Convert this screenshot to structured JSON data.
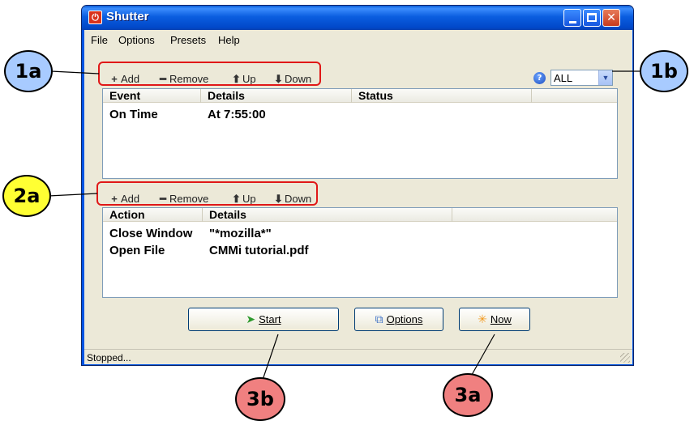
{
  "window": {
    "title": "Shutter"
  },
  "menu": [
    "File",
    "Options",
    "Presets",
    "Help"
  ],
  "event_toolbar": {
    "add": "Add",
    "remove": "Remove",
    "up": "Up",
    "down": "Down"
  },
  "action_toolbar": {
    "add": "Add",
    "remove": "Remove",
    "up": "Up",
    "down": "Down"
  },
  "filter": {
    "value": "ALL"
  },
  "events_table": {
    "headers": [
      "Event",
      "Details",
      "Status"
    ],
    "rows": [
      {
        "event": "On Time",
        "details": "At 7:55:00",
        "status": ""
      }
    ]
  },
  "actions_table": {
    "headers": [
      "Action",
      "Details"
    ],
    "rows": [
      {
        "action": "Close Window",
        "details": "\"*mozilla*\""
      },
      {
        "action": "Open File",
        "details": "CMMi tutorial.pdf"
      }
    ]
  },
  "buttons": {
    "start": "Start",
    "options": "Options",
    "now": "Now"
  },
  "status": {
    "text": "Stopped..."
  },
  "callouts": {
    "c1a": "1a",
    "c1b": "1b",
    "c2a": "2a",
    "c3a": "3a",
    "c3b": "3b"
  },
  "colors": {
    "callout_blue": "#a8cbff",
    "callout_yellow": "#ffff33",
    "callout_red": "#f08080",
    "highlight": "#e01818",
    "titlebar": "#0b5ee0"
  }
}
